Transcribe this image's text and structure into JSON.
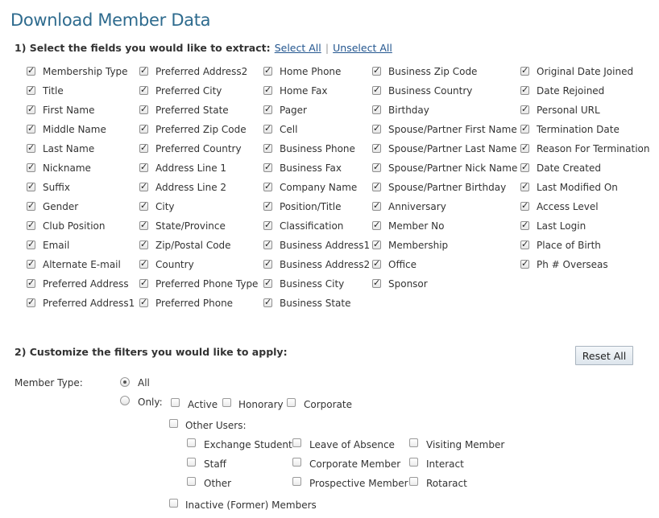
{
  "page_title": "Download Member Data",
  "step1": {
    "label": "1) Select the fields you would like to extract:",
    "select_all": "Select All",
    "separator": "|",
    "unselect_all": "Unselect All"
  },
  "field_columns": [
    [
      "Membership Type",
      "Title",
      "First Name",
      "Middle Name",
      "Last Name",
      "Nickname",
      "Suffix",
      "Gender",
      "Club Position",
      "Email",
      "Alternate E-mail",
      "Preferred Address",
      "Preferred Address1"
    ],
    [
      "Preferred Address2",
      "Preferred City",
      "Preferred State",
      "Preferred Zip Code",
      "Preferred Country",
      "Address Line 1",
      "Address Line 2",
      "City",
      "State/Province",
      "Zip/Postal Code",
      "Country",
      "Preferred Phone Type",
      "Preferred Phone"
    ],
    [
      "Home Phone",
      "Home Fax",
      "Pager",
      "Cell",
      "Business Phone",
      "Business Fax",
      "Company Name",
      "Position/Title",
      "Classification",
      "Business Address1",
      "Business Address2",
      "Business City",
      "Business State"
    ],
    [
      "Business Zip Code",
      "Business Country",
      "Birthday",
      "Spouse/Partner First Name",
      "Spouse/Partner Last Name",
      "Spouse/Partner Nick Name",
      "Spouse/Partner Birthday",
      "Anniversary",
      "Member No",
      "Membership",
      "Office",
      "Sponsor"
    ],
    [
      "Original Date Joined",
      "Date Rejoined",
      "Personal URL",
      "Termination Date",
      "Reason For Termination",
      "Date Created",
      "Last Modified On",
      "Access Level",
      "Last Login",
      "Place of Birth",
      "Ph # Overseas"
    ]
  ],
  "fields_checked": true,
  "step2": {
    "label": "2) Customize the filters you would like to apply:",
    "reset_all": "Reset All"
  },
  "member_type": {
    "label": "Member Type:",
    "all_label": "All",
    "only_label": "Only:",
    "selected": "All",
    "only_options": [
      "Active",
      "Honorary",
      "Corporate"
    ],
    "other_users_label": "Other Users:",
    "other_users_columns": [
      [
        "Exchange Student",
        "Staff",
        "Other"
      ],
      [
        "Leave of Absence",
        "Corporate Member",
        "Prospective Member"
      ],
      [
        "Visiting Member",
        "Interact",
        "Rotaract"
      ]
    ],
    "inactive_label": "Inactive (Former) Members"
  }
}
